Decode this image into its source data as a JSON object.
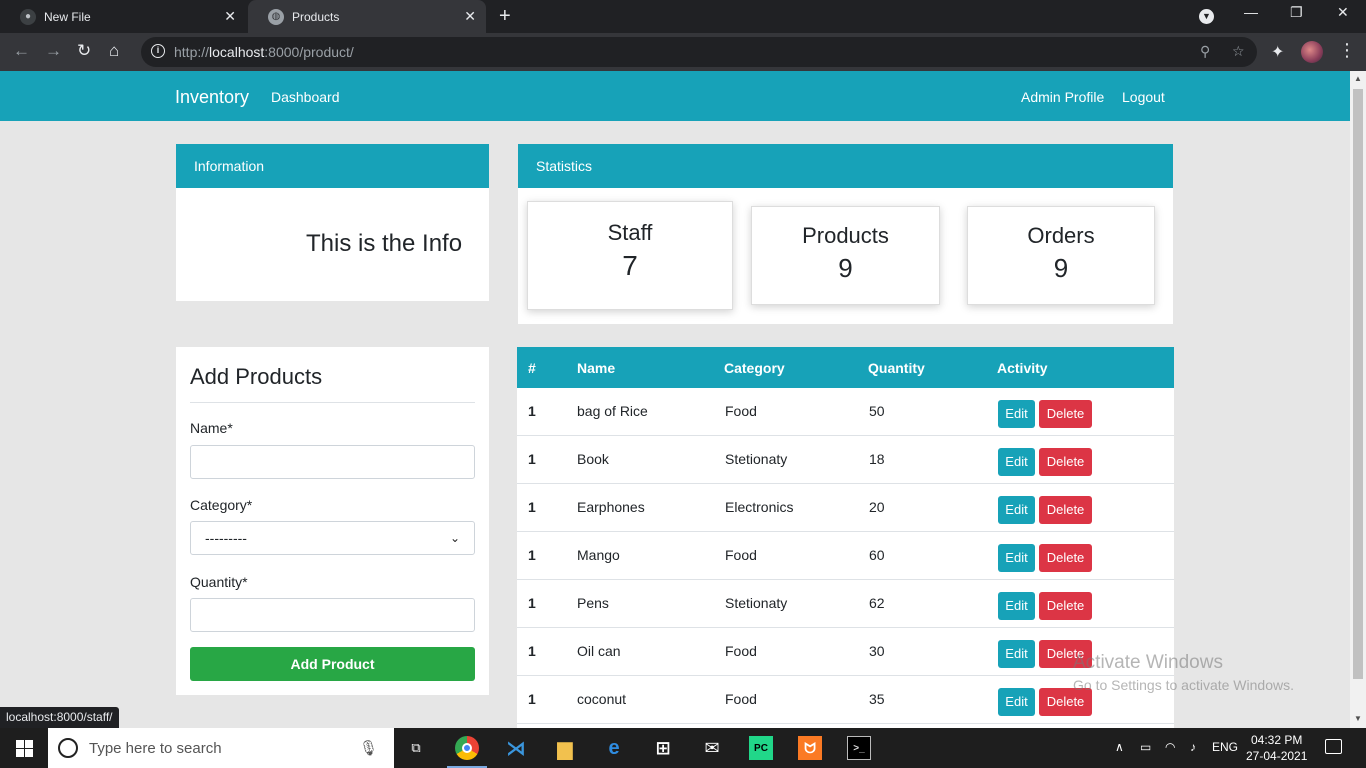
{
  "browser": {
    "tabs": [
      {
        "label": "New File",
        "favicon": "github-icon"
      },
      {
        "label": "Products",
        "favicon": "globe-icon"
      }
    ],
    "url_host": "localhost",
    "url_rest": ":8000/product/",
    "url_scheme": "http://",
    "status_link": "localhost:8000/staff/"
  },
  "nav": {
    "brand": "Inventory",
    "dashboard": "Dashboard",
    "admin_profile": "Admin Profile",
    "logout": "Logout"
  },
  "info_card": {
    "header": "Information",
    "text": "This is the Info"
  },
  "stats_card": {
    "header": "Statistics",
    "items": [
      {
        "label": "Staff",
        "value": "7"
      },
      {
        "label": "Products",
        "value": "9"
      },
      {
        "label": "Orders",
        "value": "9"
      }
    ]
  },
  "add_form": {
    "title": "Add Products",
    "name_label": "Name*",
    "name_value": "",
    "category_label": "Category*",
    "category_selected": "---------",
    "quantity_label": "Quantity*",
    "quantity_value": "",
    "submit_label": "Add Product"
  },
  "table": {
    "headers": [
      "#",
      "Name",
      "Category",
      "Quantity",
      "Activity"
    ],
    "edit_label": "Edit",
    "delete_label": "Delete",
    "rows": [
      {
        "num": "1",
        "name": "bag of Rice",
        "category": "Food",
        "quantity": "50"
      },
      {
        "num": "1",
        "name": "Book",
        "category": "Stetionaty",
        "quantity": "18"
      },
      {
        "num": "1",
        "name": "Earphones",
        "category": "Electronics",
        "quantity": "20"
      },
      {
        "num": "1",
        "name": "Mango",
        "category": "Food",
        "quantity": "60"
      },
      {
        "num": "1",
        "name": "Pens",
        "category": "Stetionaty",
        "quantity": "62"
      },
      {
        "num": "1",
        "name": "Oil can",
        "category": "Food",
        "quantity": "30"
      },
      {
        "num": "1",
        "name": "coconut",
        "category": "Food",
        "quantity": "35"
      }
    ]
  },
  "watermark": {
    "title": "Activate Windows",
    "subtitle": "Go to Settings to activate Windows."
  },
  "taskbar": {
    "search_placeholder": "Type here to search",
    "language": "ENG",
    "time": "04:32 PM",
    "date": "27-04-2021"
  },
  "colors": {
    "primary": "#17a2b8",
    "success": "#28a745",
    "danger": "#dc3545"
  }
}
